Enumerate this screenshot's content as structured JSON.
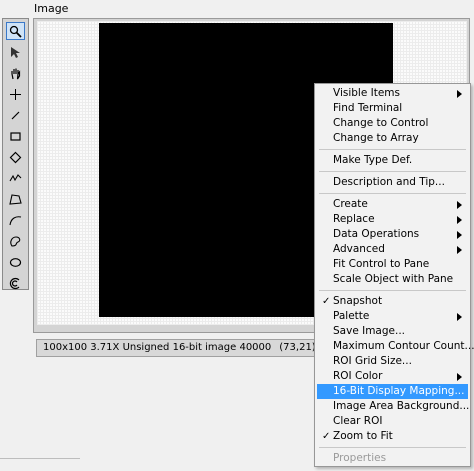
{
  "window": {
    "title": "Image"
  },
  "tools": [
    {
      "name": "zoom-tool",
      "icon": "magnifier-icon",
      "selected": true
    },
    {
      "name": "pointer-tool",
      "icon": "arrow-pointer-icon"
    },
    {
      "name": "pan-tool",
      "icon": "hand-icon"
    },
    {
      "name": "point-tool",
      "icon": "crosshair-icon"
    },
    {
      "name": "line-tool",
      "icon": "line-icon"
    },
    {
      "name": "rectangle-tool",
      "icon": "rectangle-icon"
    },
    {
      "name": "rotated-rectangle-tool",
      "icon": "diamond-icon"
    },
    {
      "name": "freehand-line-tool",
      "icon": "freehand-line-icon"
    },
    {
      "name": "polygon-tool",
      "icon": "polygon-icon"
    },
    {
      "name": "freehand-curve-tool",
      "icon": "curve-icon"
    },
    {
      "name": "freehand-region-tool",
      "icon": "freehand-region-icon"
    },
    {
      "name": "oval-tool",
      "icon": "oval-icon"
    },
    {
      "name": "annulus-tool",
      "icon": "annulus-icon"
    }
  ],
  "status": {
    "info": "100x100 3.71X Unsigned 16-bit image 40000",
    "coords": "(73,21)"
  },
  "menu": {
    "items": [
      {
        "label": "Visible Items",
        "submenu": true
      },
      {
        "label": "Find Terminal"
      },
      {
        "label": "Change to Control"
      },
      {
        "label": "Change to Array"
      },
      {
        "label": "Make Type Def."
      },
      {
        "label": "Description and Tip..."
      },
      {
        "label": "Create",
        "submenu": true
      },
      {
        "label": "Replace",
        "submenu": true
      },
      {
        "label": "Data Operations",
        "submenu": true
      },
      {
        "label": "Advanced",
        "submenu": true
      },
      {
        "label": "Fit Control to Pane"
      },
      {
        "label": "Scale Object with Pane"
      },
      {
        "label": "Snapshot",
        "checked": true
      },
      {
        "label": "Palette",
        "submenu": true
      },
      {
        "label": "Save Image..."
      },
      {
        "label": "Maximum Contour Count..."
      },
      {
        "label": "ROI Grid Size..."
      },
      {
        "label": "ROI Color",
        "submenu": true
      },
      {
        "label": "16-Bit Display Mapping...",
        "highlighted": true
      },
      {
        "label": "Image Area Background..."
      },
      {
        "label": "Clear ROI"
      },
      {
        "label": "Zoom to Fit",
        "checked": true
      },
      {
        "label": "Properties",
        "disabled": true
      }
    ]
  }
}
